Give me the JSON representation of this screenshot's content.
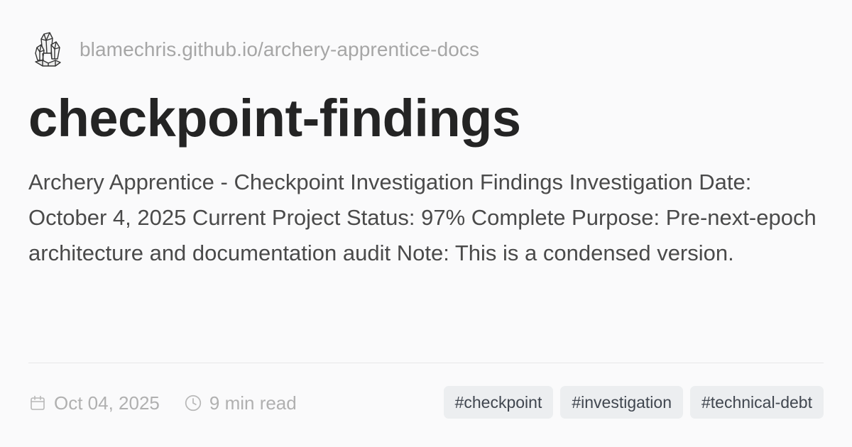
{
  "site": {
    "logo_icon": "crystal-icon",
    "url": "blamechris.github.io/archery-apprentice-docs"
  },
  "page": {
    "title": "checkpoint-findings",
    "description": "Archery Apprentice - Checkpoint Investigation Findings Investigation Date: October 4, 2025 Current Project Status: 97% Complete Purpose: Pre-next-epoch architecture and documentation audit Note: This is a condensed version."
  },
  "meta": {
    "date_icon": "calendar-icon",
    "date": "Oct 04, 2025",
    "read_icon": "clock-icon",
    "read_time": "9 min read"
  },
  "tags": [
    "#checkpoint",
    "#investigation",
    "#technical-debt"
  ],
  "colors": {
    "background": "#fafafb",
    "title": "#242424",
    "muted": "#a6a6a6",
    "tag_bg": "#eceef0",
    "tag_text": "#40464f"
  }
}
